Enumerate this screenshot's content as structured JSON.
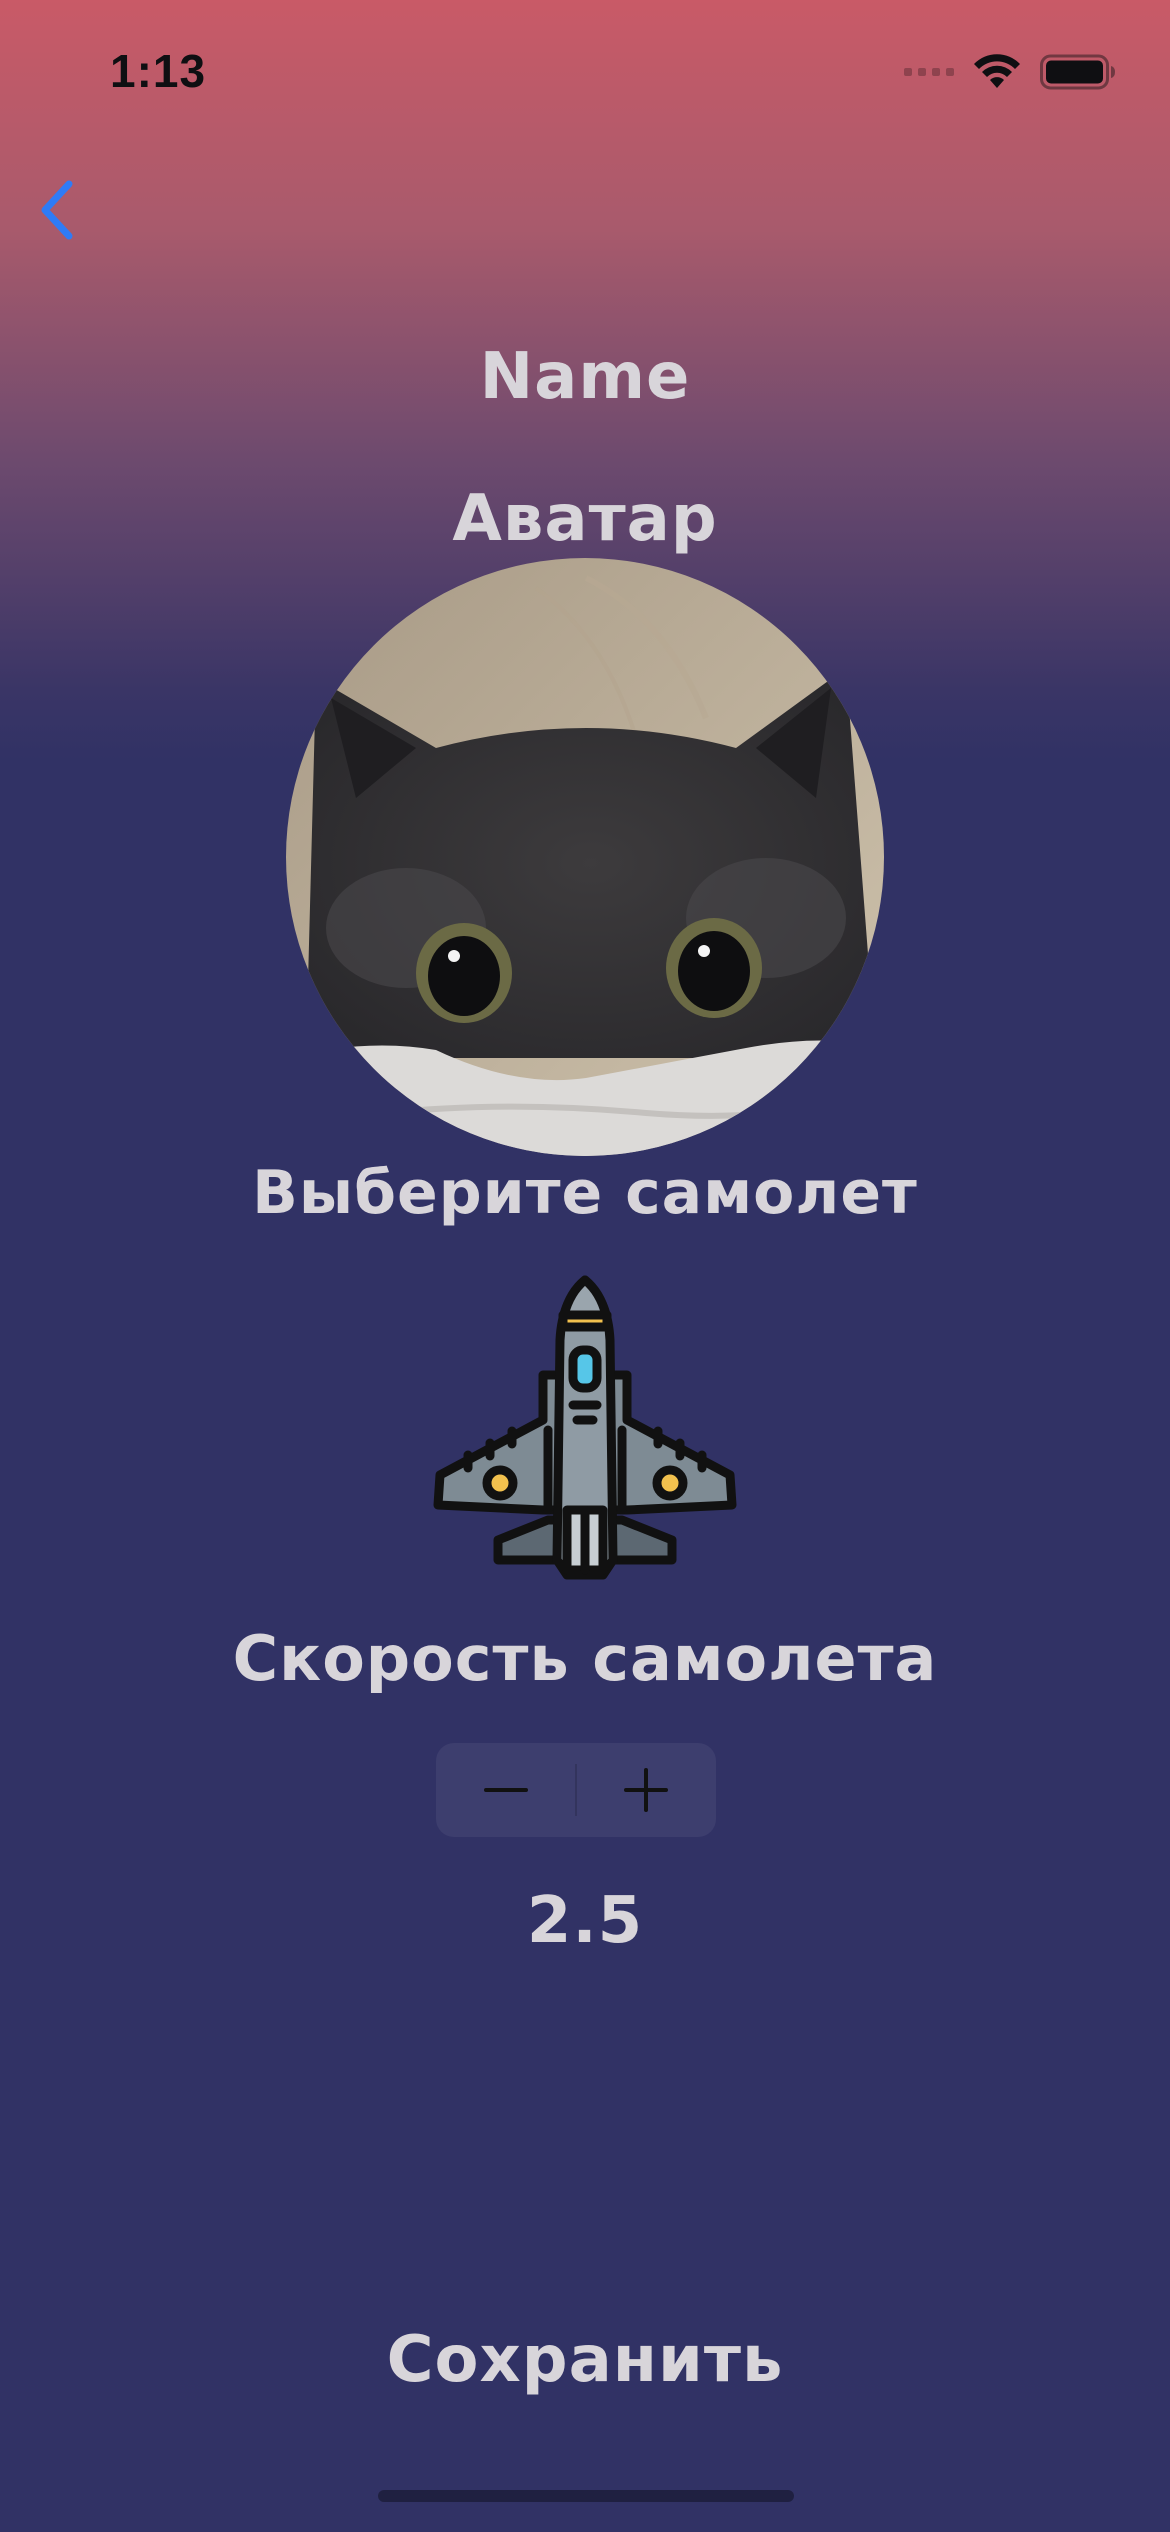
{
  "status_bar": {
    "time": "1:13",
    "icons": [
      "cellular-signal-icon",
      "wifi-icon",
      "battery-icon"
    ]
  },
  "nav": {
    "back_icon": "chevron-left-icon",
    "accent_color": "#2f7bf6"
  },
  "profile": {
    "name_label": "Name",
    "avatar_label": "Аватар",
    "avatar_image": "cat-photo"
  },
  "plane": {
    "choose_label": "Выберите самолет",
    "icon": "fighter-jet-icon"
  },
  "speed": {
    "label": "Скорость самолета",
    "decrement_icon": "minus-icon",
    "increment_icon": "plus-icon",
    "value": "2.5"
  },
  "actions": {
    "save_label": "Сохранить"
  },
  "colors": {
    "gradient_top": "#c95a67",
    "background": "#313265",
    "text": "#d8d5da"
  }
}
